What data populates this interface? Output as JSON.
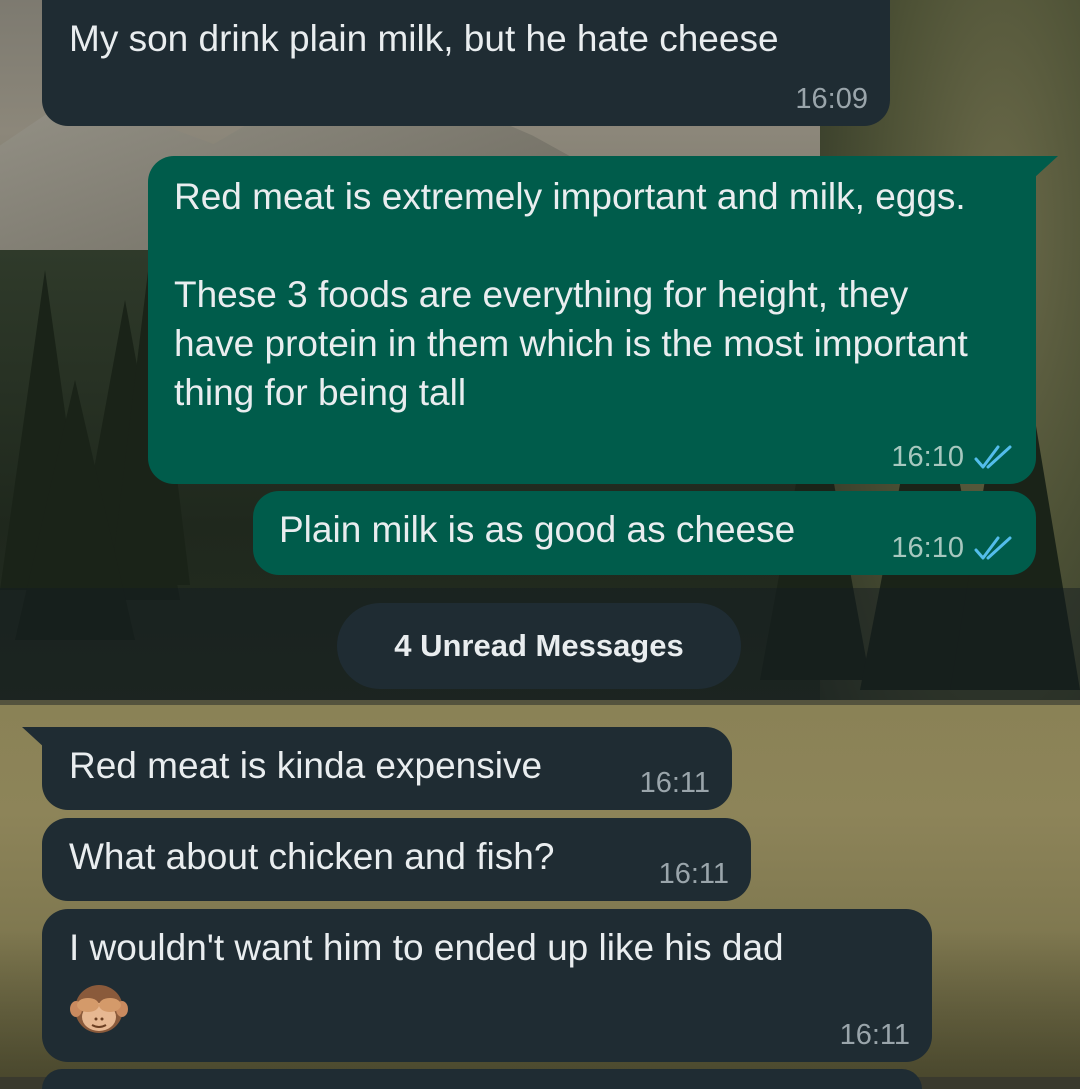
{
  "theme": {
    "incoming_bubble": "#1f2c33",
    "outgoing_bubble": "#005c4b",
    "text": "#e9edef",
    "meta_text": "#9aa5ab",
    "read_ticks": "#53bdeb"
  },
  "messages": [
    {
      "direction": "incoming",
      "text": "My son drink plain milk, but he hate cheese",
      "time": "16:09"
    },
    {
      "direction": "outgoing",
      "text": "Red meat is extremely important and milk, eggs.\n\nThese 3 foods are everything for height, they have protein in them which is the most important thing for being tall",
      "time": "16:10",
      "status_icon": "double-check-read-icon"
    },
    {
      "direction": "outgoing",
      "text": "Plain milk is as good as cheese",
      "time": "16:10",
      "status_icon": "double-check-read-icon"
    },
    {
      "direction": "incoming",
      "text": "Red meat is kinda expensive",
      "time": "16:11"
    },
    {
      "direction": "incoming",
      "text": "What about chicken and fish?",
      "time": "16:11"
    },
    {
      "direction": "incoming",
      "text": "I wouldn't want him to ended up like his dad",
      "time": "16:11",
      "emoji": "see-no-evil-monkey-emoji"
    }
  ],
  "unread_divider": {
    "label": "4 Unread Messages"
  }
}
